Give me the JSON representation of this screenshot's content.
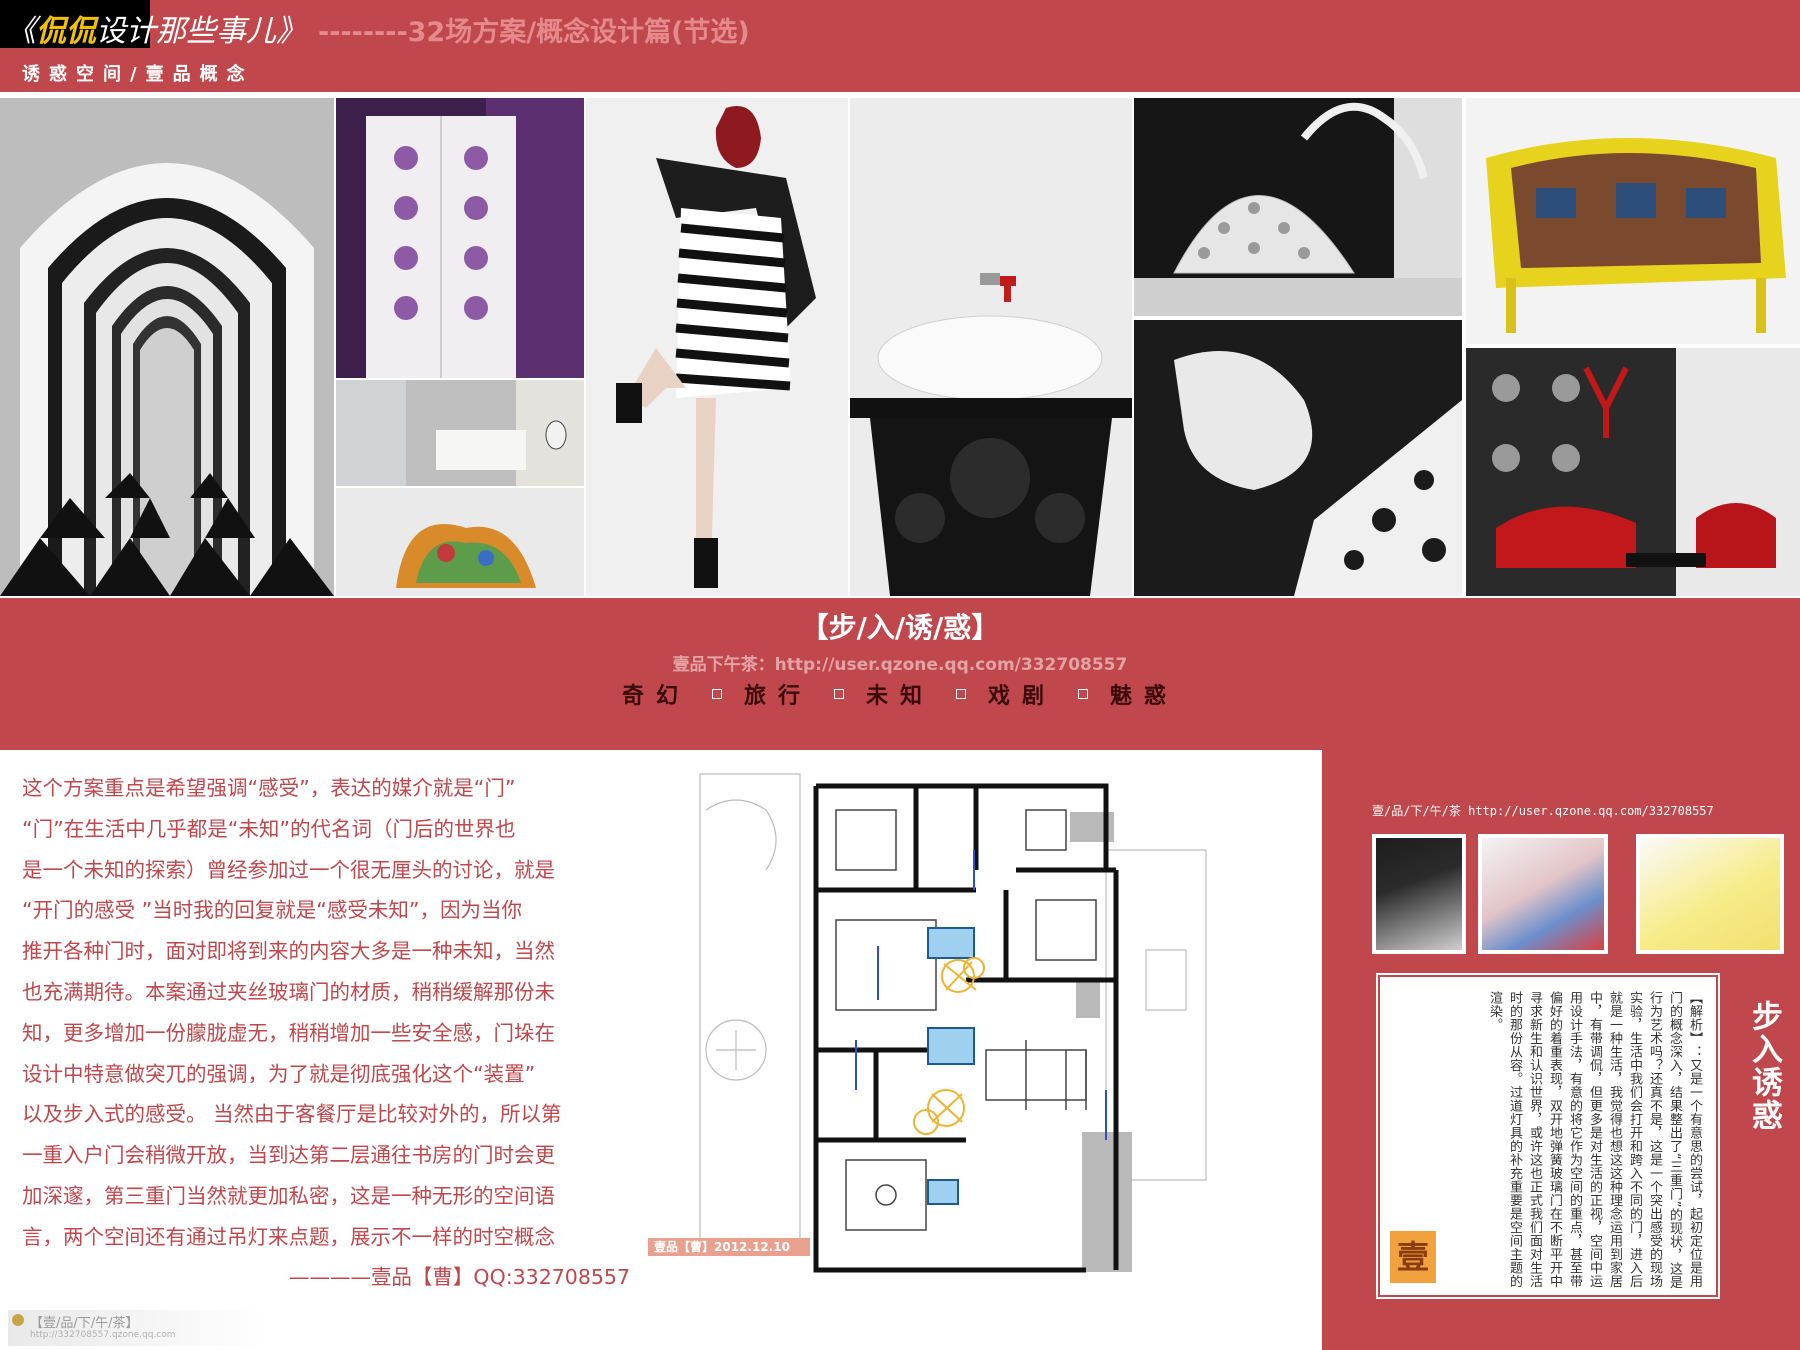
{
  "header": {
    "title_script_open": "《",
    "title_script_highlight": "侃侃",
    "title_script_rest": "设计那些事儿》",
    "title_tail": "--------32场方案/概念设计篇(节选)",
    "subtitle": "诱惑空间/壹品概念"
  },
  "band": {
    "title": "【步/入/诱/惑】",
    "url_line": "壹品下午茶：http://user.qzone.qq.com/332708557",
    "keywords": [
      "奇幻",
      "旅行",
      "未知",
      "戏剧",
      "魅惑"
    ]
  },
  "left_text": {
    "lines": [
      "这个方案重点是希望强调“感受”，表达的媒介就是“门”",
      "“门”在生活中几乎都是“未知”的代名词（门后的世界也",
      "是一个未知的探索）曾经参加过一个很无厘头的讨论，就是",
      "“开门的感受 ”当时我的回复就是“感受未知”，因为当你",
      "推开各种门时，面对即将到来的内容大多是一种未知，当然",
      "也充满期待。本案通过夹丝玻璃门的材质，稍稍缓解那份未",
      "知，更多增加一份朦胧虚无，稍稍增加一些安全感，门垛在",
      "设计中特意做突兀的强调，为了就是彻底强化这个“装置”",
      "以及步入式的感受。 当然由于客餐厅是比较对外的，所以第",
      "一重入户门会稍微开放，当到达第二层通往书房的门时会更",
      "加深邃，第三重门当然就更加私密，这是一种无形的空间语",
      "言，两个空间还有通过吊灯来点题，展示不一样的时空概念"
    ],
    "signature": "————壹品【曹】QQ:332708557",
    "watermark_main": "【壹/品/下/午/茶】",
    "watermark_url": "http://332708557.qzone.qq.com"
  },
  "plan": {
    "date_label": "壹品【曹】2012.12.10"
  },
  "right_panel": {
    "url": "壹/品/下/午/茶  http://user.qzone.qq.com/332708557",
    "note_text": "【解析】：又是一个有意思的尝试，起初定位是用门的概念深入，结果整出了“三重门”的现状，这是行为艺术吗？还真不是，这是一个突出感受的现场实验，生活中我们会打开和跨入不同的门，进入后就是一种生活，我觉得也想这这种理念运用到家居中，有带调侃，但更多是对生活的正视，空间中运用设计手法，有意的将它作为空间的重点，甚至带偏好的着重表现，双开地弹簧玻璃门在不断平开中寻求新生和认识世界，或许这也正式我们面对生活时的那份从容。过道灯具的补充重要是空间主题的渲染。",
    "seal_char": "壹",
    "vertical_title": "步入诱惑"
  },
  "colors": {
    "brand_red": "#c0474b",
    "accent_yellow": "#f2c200",
    "blue_glass": "#9fd0ef",
    "lamp_yellow": "#f0b232"
  }
}
